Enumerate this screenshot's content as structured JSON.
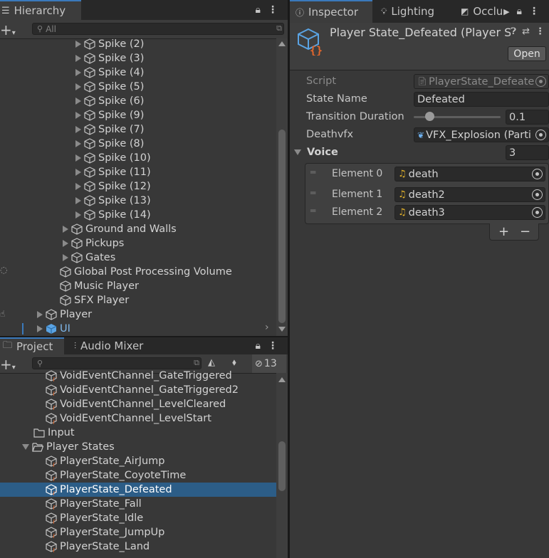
{
  "hierarchy": {
    "tab_label": "Hierarchy",
    "search_placeholder": "All",
    "items": [
      {
        "label": "Spike (2)"
      },
      {
        "label": "Spike (3)"
      },
      {
        "label": "Spike (4)"
      },
      {
        "label": "Spike (5)"
      },
      {
        "label": "Spike (6)"
      },
      {
        "label": "Spike (9)"
      },
      {
        "label": "Spike (7)"
      },
      {
        "label": "Spike (8)"
      },
      {
        "label": "Spike (10)"
      },
      {
        "label": "Spike (11)"
      },
      {
        "label": "Spike (12)"
      },
      {
        "label": "Spike (13)"
      },
      {
        "label": "Spike (14)"
      },
      {
        "label": "Ground and Walls"
      },
      {
        "label": "Pickups"
      },
      {
        "label": "Gates"
      },
      {
        "label": "Global Post Processing Volume"
      },
      {
        "label": "Music Player"
      },
      {
        "label": "SFX Player"
      },
      {
        "label": "Player"
      },
      {
        "label": "UI"
      }
    ]
  },
  "project": {
    "tab_label": "Project",
    "tab2_label": "Audio Mixer",
    "hidden_count": "13",
    "items": [
      {
        "label": "VoidEventChannel_GateTriggered"
      },
      {
        "label": "VoidEventChannel_GateTriggered2"
      },
      {
        "label": "VoidEventChannel_LevelCleared"
      },
      {
        "label": "VoidEventChannel_LevelStart"
      },
      {
        "label": "Input"
      },
      {
        "label": "Player States"
      },
      {
        "label": "PlayerState_AirJump"
      },
      {
        "label": "PlayerState_CoyoteTime"
      },
      {
        "label": "PlayerState_Defeated"
      },
      {
        "label": "PlayerState_Fall"
      },
      {
        "label": "PlayerState_Idle"
      },
      {
        "label": "PlayerState_JumpUp"
      },
      {
        "label": "PlayerState_Land"
      }
    ]
  },
  "inspector": {
    "tabs": [
      {
        "label": "Inspector"
      },
      {
        "label": "Lighting"
      },
      {
        "label": "Occlu"
      }
    ],
    "title": "Player State_Defeated (Player S",
    "open_label": "Open",
    "props": {
      "script_label": "Script",
      "script_value": "PlayerState_Defeate",
      "state_name_label": "State Name",
      "state_name_value": "Defeated",
      "transition_label": "Transition Duration",
      "transition_value": "0.1",
      "transition_fraction": 0.15,
      "deathvfx_label": "Deathvfx",
      "deathvfx_value": "VFX_Explosion (Parti",
      "voice_label": "Voice",
      "voice_size": "3"
    },
    "elements": [
      {
        "label": "Element 0",
        "value": "death"
      },
      {
        "label": "Element 1",
        "value": "death2"
      },
      {
        "label": "Element 2",
        "value": "death3"
      }
    ],
    "add_label": "+",
    "remove_label": "−"
  },
  "colors": {
    "accent": "#3a79bb",
    "selection": "#2c5d87",
    "background": "#383838",
    "tabbar": "#282828",
    "audio_icon": "#e2b22a"
  }
}
